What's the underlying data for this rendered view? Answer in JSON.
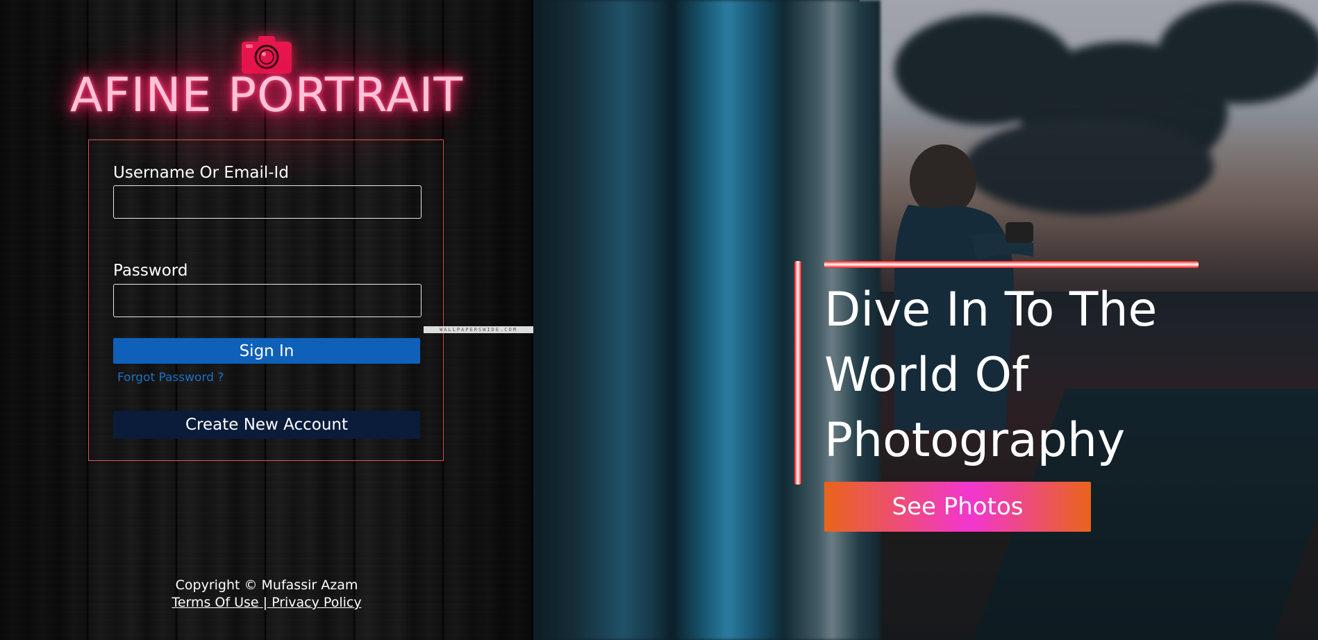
{
  "brand": {
    "title": "AFINE PORTRAIT",
    "icon": "camera-icon",
    "color": "#ff2a6d"
  },
  "login": {
    "username_label": "Username Or Email-Id",
    "username_value": "",
    "password_label": "Password",
    "password_value": "",
    "signin_label": "Sign In",
    "forgot_label": "Forgot Password ?",
    "create_label": "Create New Account",
    "border_color": "#e05252",
    "signin_color": "#0f60b8",
    "create_color": "#0b1c3a"
  },
  "footer": {
    "copyright": "Copyright © Mufassir Azam",
    "terms_label": "Terms Of Use",
    "separator": " | ",
    "privacy_label": "Privacy Policy"
  },
  "watermark": "WALLPAPERSWIDE.COM",
  "hero": {
    "heading_line1": "Dive In To The",
    "heading_line2": "World Of",
    "heading_line3": "Photography",
    "cta_label": "See Photos",
    "accent_color": "#ff1010",
    "cta_gradient": [
      "#e8651a",
      "#f236d0"
    ]
  }
}
